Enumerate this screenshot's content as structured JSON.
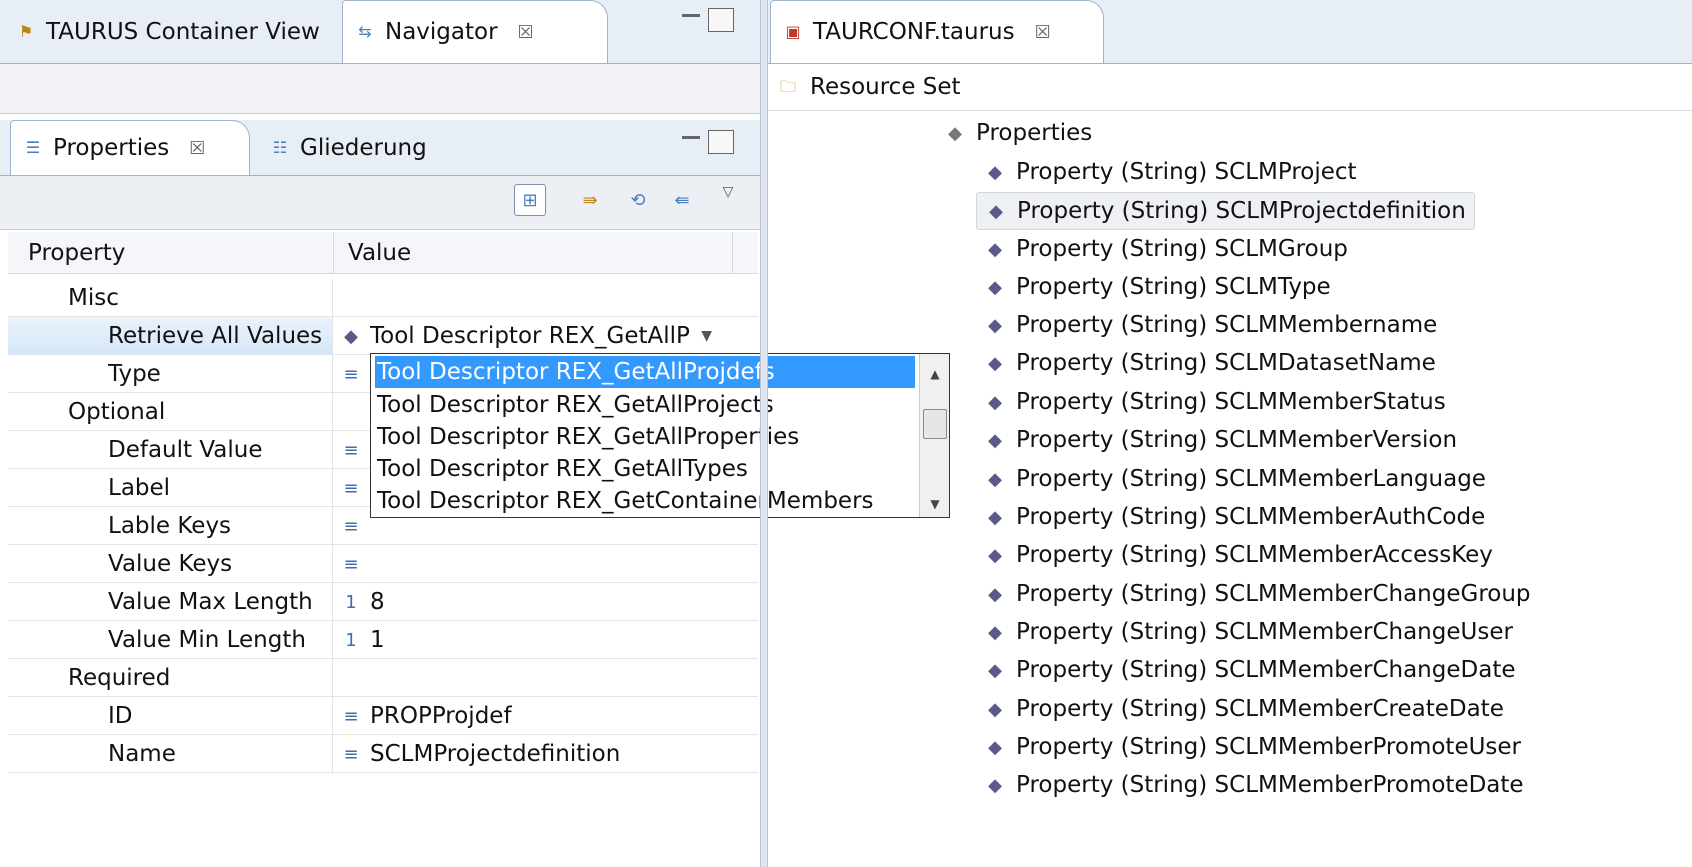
{
  "left_top": {
    "tabs": [
      {
        "label": "TAURUS Container View",
        "icon": "container-view-icon"
      },
      {
        "label": "Navigator",
        "icon": "navigator-icon",
        "close": "☒"
      }
    ]
  },
  "properties_view": {
    "tabs": [
      {
        "label": "Properties",
        "icon": "properties-icon",
        "close": "☒"
      },
      {
        "label": "Gliederung",
        "icon": "outline-icon"
      }
    ],
    "toolbar": [
      "categories-icon",
      "advanced-icon",
      "restore-default-icon",
      "filter-icon"
    ],
    "columns": {
      "property": "Property",
      "value": "Value"
    },
    "rows": [
      {
        "label": "Misc",
        "level": 1,
        "value": "",
        "icon": ""
      },
      {
        "label": "Retrieve All Values",
        "level": 2,
        "value": "Tool Descriptor REX_GetAllP",
        "icon": "◆",
        "selected": true,
        "combo": true
      },
      {
        "label": "Type",
        "level": 2,
        "value": "",
        "icon": "≡"
      },
      {
        "label": "Optional",
        "level": 1,
        "value": "",
        "icon": ""
      },
      {
        "label": "Default Value",
        "level": 2,
        "value": "",
        "icon": "≡"
      },
      {
        "label": "Label",
        "level": 2,
        "value": "",
        "icon": "≡"
      },
      {
        "label": "Lable Keys",
        "level": 2,
        "value": "",
        "icon": "≡"
      },
      {
        "label": "Value Keys",
        "level": 2,
        "value": "",
        "icon": "≡"
      },
      {
        "label": "Value Max Length",
        "level": 2,
        "value": "8",
        "icon": "1"
      },
      {
        "label": "Value Min Length",
        "level": 2,
        "value": "1",
        "icon": "1"
      },
      {
        "label": "Required",
        "level": 1,
        "value": "",
        "icon": ""
      },
      {
        "label": "ID",
        "level": 2,
        "value": "PROPProjdef",
        "icon": "≡"
      },
      {
        "label": "Name",
        "level": 2,
        "value": "SCLMProjectdefinition",
        "icon": "≡"
      }
    ],
    "dropdown_options": [
      {
        "label": "Tool Descriptor REX_GetAllProjdefs",
        "selected": true
      },
      {
        "label": "Tool Descriptor REX_GetAllProjects"
      },
      {
        "label": "Tool Descriptor REX_GetAllProperties"
      },
      {
        "label": "Tool Descriptor REX_GetAllTypes"
      },
      {
        "label": "Tool Descriptor REX_GetContainerMembers"
      }
    ]
  },
  "editor": {
    "tab": {
      "label": "TAURCONF.taurus",
      "icon": "taurus-file-icon",
      "close": "☒"
    },
    "root": {
      "label": "Resource Set",
      "icon": "resource-set-icon"
    },
    "properties_node": "Properties",
    "items": [
      {
        "label": "Property (String) SCLMProject"
      },
      {
        "label": "Property (String) SCLMProjectdefinition",
        "selected": true
      },
      {
        "label": "Property (String) SCLMGroup"
      },
      {
        "label": "Property (String) SCLMType"
      },
      {
        "label": "Property (String) SCLMMembername"
      },
      {
        "label": "Property (String) SCLMDatasetName"
      },
      {
        "label": "Property (String) SCLMMemberStatus"
      },
      {
        "label": "Property (String) SCLMMemberVersion"
      },
      {
        "label": "Property (String) SCLMMemberLanguage"
      },
      {
        "label": "Property (String) SCLMMemberAuthCode"
      },
      {
        "label": "Property (String) SCLMMemberAccessKey"
      },
      {
        "label": "Property (String) SCLMMemberChangeGroup"
      },
      {
        "label": "Property (String) SCLMMemberChangeUser"
      },
      {
        "label": "Property (String) SCLMMemberChangeDate"
      },
      {
        "label": "Property (String) SCLMMemberCreateDate"
      },
      {
        "label": "Property (String) SCLMMemberPromoteUser"
      },
      {
        "label": "Property (String) SCLMMemberPromoteDate"
      }
    ]
  },
  "colors": {
    "selection": "#3399ff",
    "accent_border": "#9fb3cc"
  }
}
